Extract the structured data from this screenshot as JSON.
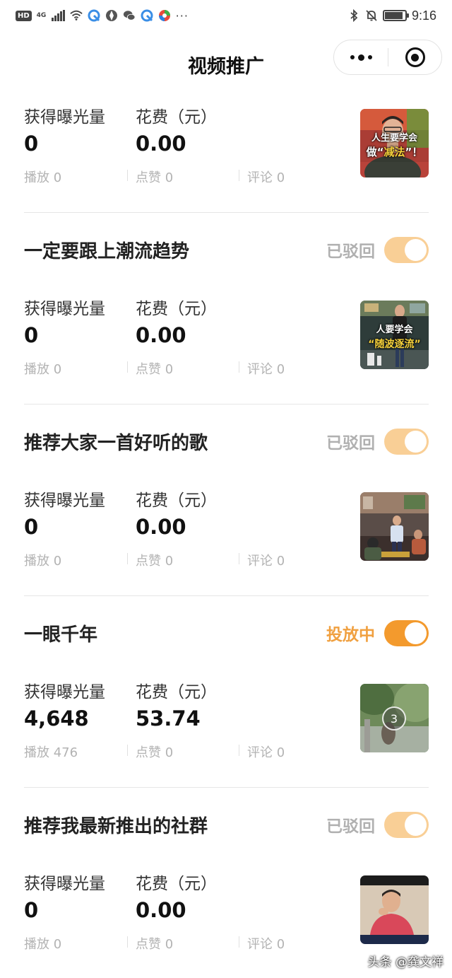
{
  "status_bar": {
    "hd": "HD",
    "network": "4G",
    "dots": "···",
    "time": "9:16"
  },
  "nav": {
    "title": "视频推广"
  },
  "labels": {
    "exposure": "获得曝光量",
    "cost": "花费（元）"
  },
  "campaigns": [
    {
      "title": "",
      "status": "",
      "exposure": "0",
      "cost": "0.00",
      "plays": "播放 0",
      "likes": "点赞 0",
      "comments": "评论 0",
      "thumb_caption_1": "人生要学会",
      "thumb_caption_2a": "做“",
      "thumb_caption_2b": "减法",
      "thumb_caption_2c": "”！"
    },
    {
      "title": "一定要跟上潮流趋势",
      "status": "已驳回",
      "exposure": "0",
      "cost": "0.00",
      "plays": "播放 0",
      "likes": "点赞 0",
      "comments": "评论 0",
      "thumb_caption_1": "人要学会",
      "thumb_caption_2": "“随波逐流”"
    },
    {
      "title": "推荐大家一首好听的歌",
      "status": "已驳回",
      "exposure": "0",
      "cost": "0.00",
      "plays": "播放 0",
      "likes": "点赞 0",
      "comments": "评论 0"
    },
    {
      "title": "一眼千年",
      "status": "投放中",
      "exposure": "4,648",
      "cost": "53.74",
      "plays": "播放 476",
      "likes": "点赞 0",
      "comments": "评论 0",
      "thumb_countdown": "3"
    },
    {
      "title": "推荐我最新推出的社群",
      "status": "已驳回",
      "exposure": "0",
      "cost": "0.00",
      "plays": "播放 0",
      "likes": "点赞 0",
      "comments": "评论 0"
    }
  ],
  "watermark": "头条 @龚文祥",
  "colors": {
    "accent": "#f39a2d",
    "accent_light": "#f9cf96",
    "rejected_text": "#b0b0b0",
    "active_text": "#f0a040"
  }
}
